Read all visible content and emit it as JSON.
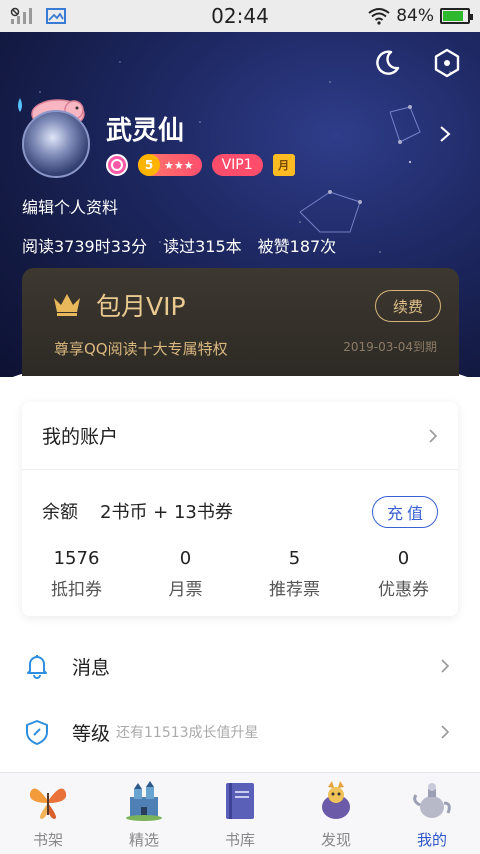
{
  "status_bar": {
    "time": "02:44",
    "battery_percent": "84%",
    "battery_level": 0.84,
    "icons": [
      "signal-off-icon",
      "gallery-icon",
      "wifi-icon",
      "battery-icon"
    ]
  },
  "header": {
    "icons": [
      "moon-icon",
      "settings-hexagon-icon"
    ]
  },
  "profile": {
    "username": "武灵仙",
    "level_number": "5",
    "level_stars": "★★★",
    "vip_label": "VIP1",
    "month_badge": "月",
    "edit_link": "编辑个人资料",
    "stats": {
      "read_time": "阅读3739时33分",
      "books_read": "读过315本",
      "likes": "被赞187次"
    }
  },
  "vip_card": {
    "title": "包月VIP",
    "subtitle": "尊享QQ阅读十大专属特权",
    "expiry": "2019-03-04到期",
    "renew_label": "续费",
    "accent_color": "#e9c98f"
  },
  "account": {
    "title": "我的账户",
    "balance_label": "余额",
    "balance_value": "2书币 + 13书券",
    "recharge_label": "充值",
    "tickets": [
      {
        "value": "1576",
        "label": "抵扣券"
      },
      {
        "value": "0",
        "label": "月票"
      },
      {
        "value": "5",
        "label": "推荐票"
      },
      {
        "value": "0",
        "label": "优惠券"
      }
    ]
  },
  "menu": {
    "messages": {
      "label": "消息"
    },
    "level": {
      "label": "等级",
      "hint": "还有11513成长值升星"
    }
  },
  "bottom_nav": {
    "active_color": "#2e58c9",
    "items": [
      {
        "label": "书架",
        "icon": "butterfly-icon"
      },
      {
        "label": "精选",
        "icon": "castle-icon"
      },
      {
        "label": "书库",
        "icon": "book-icon"
      },
      {
        "label": "发现",
        "icon": "creature-icon"
      },
      {
        "label": "我的",
        "icon": "teapot-icon"
      }
    ]
  }
}
